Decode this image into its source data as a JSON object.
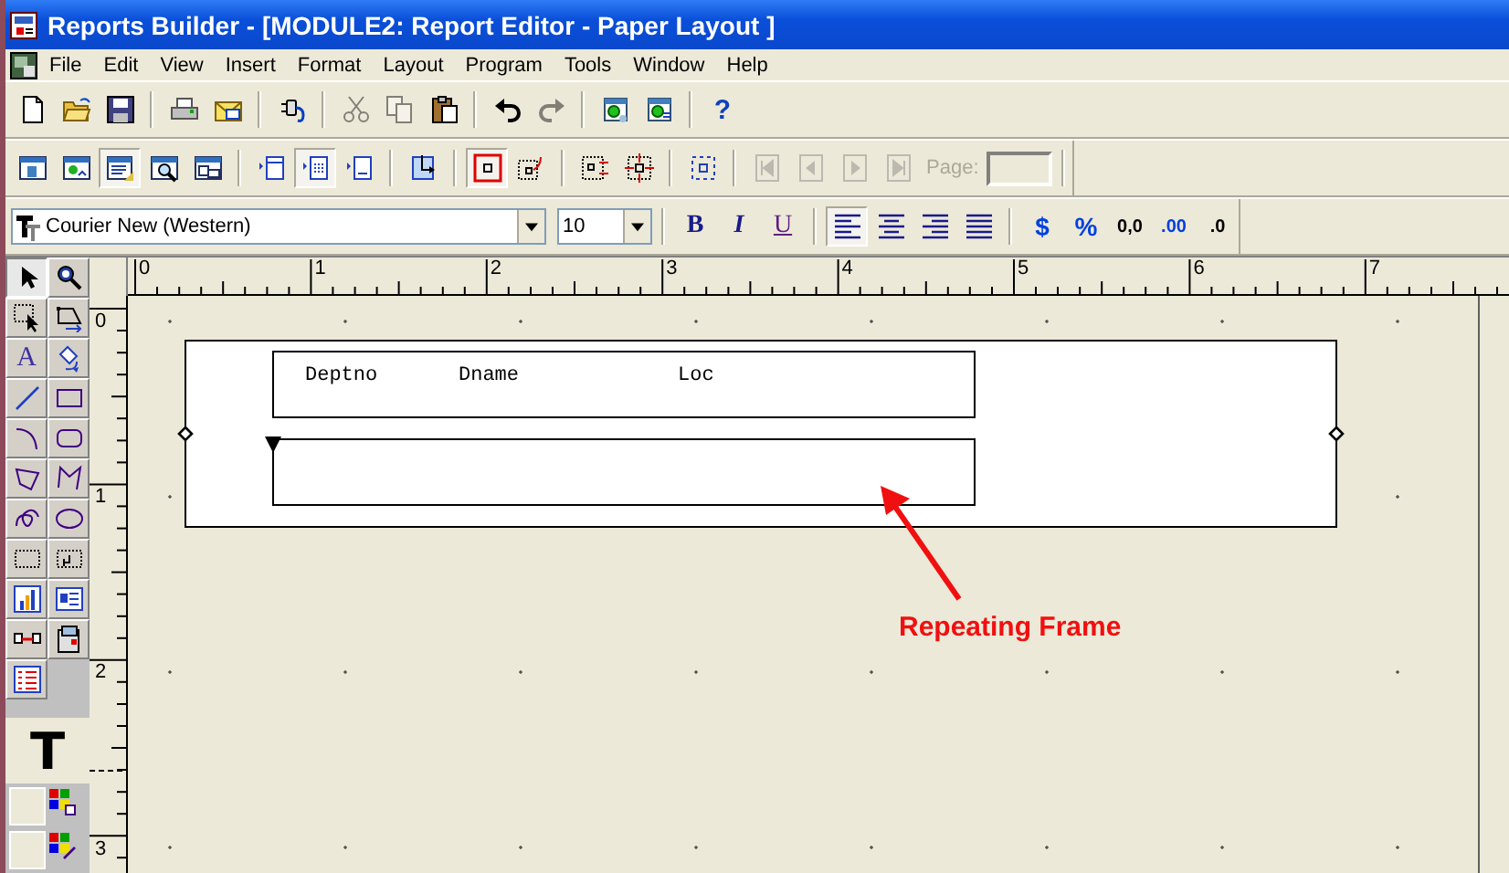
{
  "window": {
    "title": "Reports Builder - [MODULE2: Report Editor - Paper Layout ]"
  },
  "menu": [
    {
      "label": "File"
    },
    {
      "label": "Edit"
    },
    {
      "label": "View"
    },
    {
      "label": "Insert"
    },
    {
      "label": "Format"
    },
    {
      "label": "Layout"
    },
    {
      "label": "Program"
    },
    {
      "label": "Tools"
    },
    {
      "label": "Window"
    },
    {
      "label": "Help"
    }
  ],
  "main_toolbar": {
    "groups": [
      [
        {
          "disabled": false
        },
        {
          "disabled": false
        },
        {
          "disabled": false
        }
      ],
      [
        {
          "disabled": false
        },
        {
          "disabled": false
        }
      ],
      [
        {
          "disabled": false
        }
      ],
      [
        {
          "disabled": true
        },
        {
          "disabled": true
        },
        {
          "disabled": false
        }
      ],
      [
        {
          "disabled": false
        },
        {
          "disabled": true
        }
      ],
      [
        {
          "disabled": false
        },
        {
          "disabled": false
        }
      ],
      [
        {
          "label": "?",
          "disabled": false
        }
      ]
    ]
  },
  "layout_toolbar": {
    "groups": [
      [
        {
          "pressed": false,
          "disabled": false
        },
        {
          "pressed": false,
          "disabled": false
        },
        {
          "pressed": true,
          "disabled": false
        },
        {
          "pressed": false,
          "disabled": false
        },
        {
          "pressed": false,
          "disabled": false
        }
      ],
      [
        {
          "pressed": false,
          "disabled": false
        },
        {
          "pressed": true,
          "disabled": false
        },
        {
          "pressed": false,
          "disabled": false
        }
      ],
      [
        {
          "pressed": false,
          "disabled": false
        }
      ],
      [
        {
          "pressed": true,
          "disabled": false
        },
        {
          "pressed": false,
          "disabled": false
        }
      ],
      [
        {
          "pressed": false,
          "disabled": false
        },
        {
          "pressed": false,
          "disabled": false
        }
      ],
      [
        {
          "pressed": false,
          "disabled": false
        }
      ],
      [
        {
          "pressed": false,
          "disabled": true
        },
        {
          "pressed": false,
          "disabled": true
        },
        {
          "pressed": false,
          "disabled": true
        },
        {
          "pressed": false,
          "disabled": true
        }
      ]
    ],
    "page": {
      "label": "Page:",
      "disabled": true
    }
  },
  "format_toolbar": {
    "font": {
      "value": "Courier New (Western)"
    },
    "size": {
      "value": "10"
    },
    "styles": [
      {
        "label": "B"
      },
      {
        "label": "I"
      },
      {
        "label": "U"
      }
    ],
    "align": [
      {
        "pressed": true
      },
      {
        "pressed": false
      },
      {
        "pressed": false
      },
      {
        "pressed": false
      }
    ],
    "number_formats": [
      {
        "label": "$"
      },
      {
        "label": "%"
      },
      {
        "label": "0,0"
      },
      {
        "label": ".00"
      },
      {
        "label": ".0"
      }
    ]
  },
  "tool_palette": {
    "tools": [
      {
        "pressed": true
      },
      {
        "pressed": false
      },
      {
        "pressed": false
      },
      {
        "pressed": false
      },
      {
        "label": "A",
        "pressed": false
      },
      {
        "pressed": false
      },
      {
        "pressed": false
      },
      {
        "pressed": false
      },
      {
        "pressed": false
      },
      {
        "pressed": false
      },
      {
        "pressed": false
      },
      {
        "pressed": false
      },
      {
        "pressed": false
      },
      {
        "pressed": false
      },
      {
        "pressed": false
      },
      {
        "pressed": false
      },
      {
        "pressed": false
      },
      {
        "pressed": false
      },
      {
        "pressed": false
      },
      {
        "pressed": false
      },
      {
        "pressed": false
      }
    ],
    "font_preview": "T"
  },
  "rulers": {
    "horizontal": [
      "0",
      "1",
      "2",
      "3",
      "4",
      "5",
      "6",
      "7"
    ],
    "vertical": [
      "0",
      "1",
      "2",
      "3"
    ]
  },
  "layout": {
    "header_labels": [
      "Deptno",
      "Dname",
      "Loc"
    ]
  },
  "annotation": {
    "text": "Repeating Frame"
  }
}
